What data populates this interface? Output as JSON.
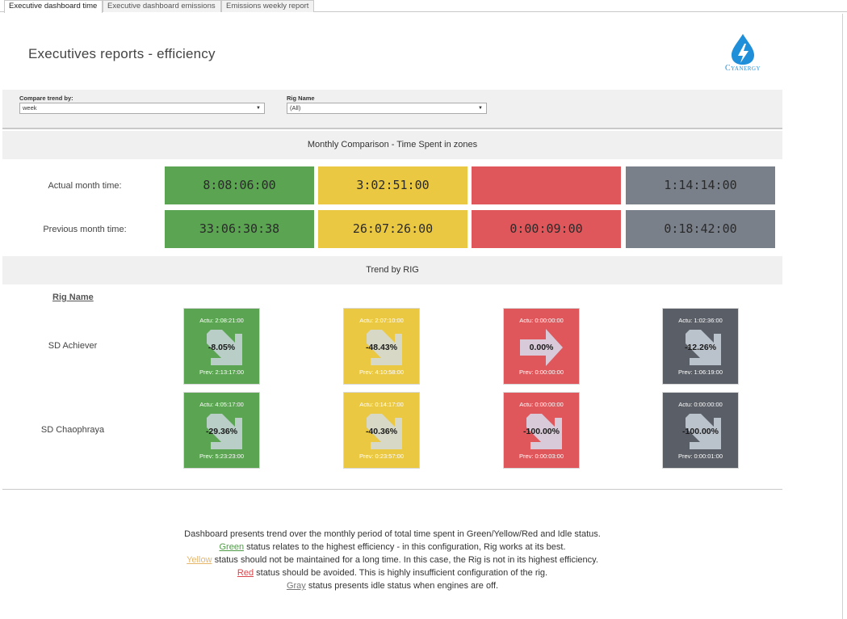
{
  "tabs": [
    "Executive dashboard time",
    "Executive dashboard emissions",
    "Emissions weekly report"
  ],
  "page_title": "Executives reports - efficiency",
  "logo_text": "Cyanergy",
  "filters": {
    "compare_label": "Compare trend by:",
    "compare_value": "week",
    "rig_label": "Rig Name",
    "rig_value": "(All)"
  },
  "monthly": {
    "title": "Monthly Comparison - Time Spent in zones",
    "actual_label": "Actual month time:",
    "previous_label": "Previous month time:",
    "actual": [
      "8:08:06:00",
      "3:02:51:00",
      "",
      "1:14:14:00"
    ],
    "previous": [
      "33:06:30:38",
      "26:07:26:00",
      "0:00:09:00",
      "0:18:42:00"
    ]
  },
  "trend": {
    "title": "Trend by RIG",
    "rig_header": "Rig Name",
    "rigs": [
      {
        "name": "SD Achiever",
        "cards": [
          {
            "actu": "Actu: 2:08:21:00",
            "pct": "-8.05%",
            "prev": "Prev: 2:13:17:00"
          },
          {
            "actu": "Actu: 2:07:10:00",
            "pct": "-48.43%",
            "prev": "Prev: 4:10:58:00"
          },
          {
            "actu": "Actu: 0:00:00:00",
            "pct": "0.00%",
            "prev": "Prev: 0:00:00:00"
          },
          {
            "actu": "Actu: 1:02:36:00",
            "pct": "-12.26%",
            "prev": "Prev: 1:06:19:00"
          }
        ]
      },
      {
        "name": "SD Chaophraya",
        "cards": [
          {
            "actu": "Actu: 4:05:17:00",
            "pct": "-29.36%",
            "prev": "Prev: 5:23:23:00"
          },
          {
            "actu": "Actu: 0:14:17:00",
            "pct": "-40.36%",
            "prev": "Prev: 0:23:57:00"
          },
          {
            "actu": "Actu: 0:00:00:00",
            "pct": "-100.00%",
            "prev": "Prev: 0:00:03:00"
          },
          {
            "actu": "Actu: 0:00:00:00",
            "pct": "-100.00%",
            "prev": "Prev: 0:00:01:00"
          }
        ]
      }
    ]
  },
  "footer": {
    "line1": "Dashboard presents trend over the monthly period of total time spent in Green/Yellow/Red and Idle status.",
    "green_kw": "Green",
    "green_rest": " status relates to the highest efficiency - in this configuration, Rig works at its best.",
    "yellow_kw": "Yellow",
    "yellow_rest": " status should not be maintained for a long time. In this case, the Rig is not in its highest efficiency.",
    "red_kw": "Red",
    "red_rest": " status should be avoided. This is highly insufficient configuration of the rig.",
    "gray_kw": "Gray",
    "gray_rest": " status presents idle status when engines are off."
  },
  "colors": {
    "green": "#5ba452",
    "yellow": "#ebc842",
    "red": "#e0575b",
    "gray": "#7a808a",
    "dark_gray": "#5a5e66",
    "logo_blue": "#1e8fd8"
  }
}
